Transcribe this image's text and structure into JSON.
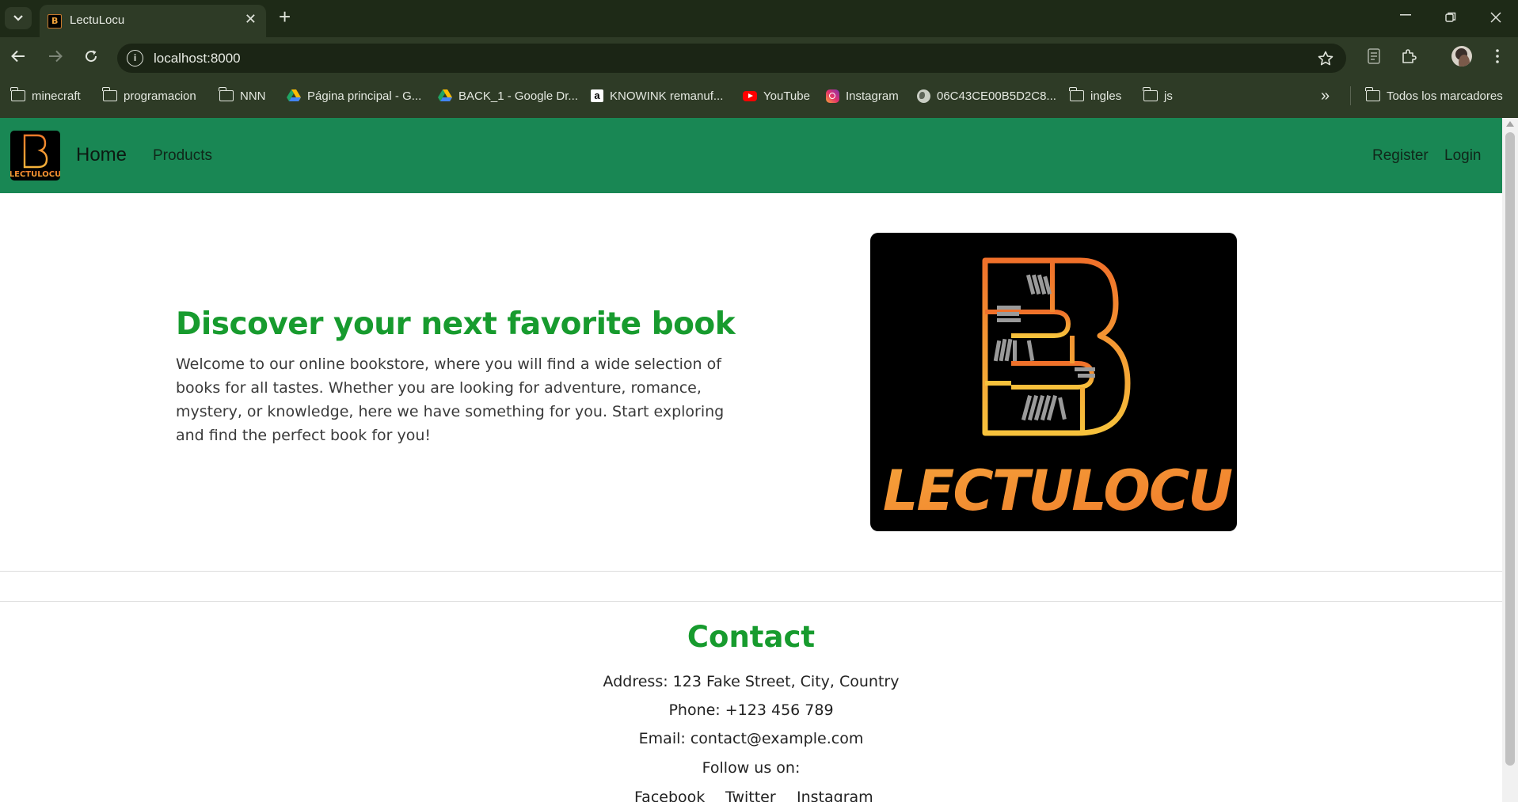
{
  "browser": {
    "tab_title": "LectuLocu",
    "tab_close": "✕",
    "new_tab": "+",
    "url": "localhost:8000",
    "bookmarks": [
      {
        "label": "minecraft",
        "icon": "folder-icon"
      },
      {
        "label": "programacion",
        "icon": "folder-icon"
      },
      {
        "label": "NNN",
        "icon": "folder-icon"
      },
      {
        "label": "Página principal - G...",
        "icon": "google-drive-icon"
      },
      {
        "label": "BACK_1 - Google Dr...",
        "icon": "google-drive-icon"
      },
      {
        "label": "KNOWINK remanuf...",
        "icon": "amazon-icon"
      },
      {
        "label": "YouTube",
        "icon": "youtube-icon"
      },
      {
        "label": "Instagram",
        "icon": "instagram-icon"
      },
      {
        "label": "06C43CE00B5D2C8...",
        "icon": "globe-icon"
      },
      {
        "label": "ingles",
        "icon": "folder-icon"
      },
      {
        "label": "js",
        "icon": "folder-icon"
      }
    ],
    "bookmarks_overflow": "»",
    "all_bookmarks": "Todos los marcadores"
  },
  "nav": {
    "logo_text": "LECTULOCU",
    "home": "Home",
    "products": "Products",
    "register": "Register",
    "login": "Login",
    "color": "#198754"
  },
  "hero": {
    "title": "Discover your next favorite book",
    "text": "Welcome to our online bookstore, where you will find a wide selection of books for all tastes. Whether you are looking for adventure, romance, mystery, or knowledge, here we have something for you. Start exploring and find the perfect book for you!",
    "image_text": "LECTULOCU",
    "accent_color": "#179b2e"
  },
  "contact": {
    "title": "Contact",
    "address": "Address: 123 Fake Street, City, Country",
    "phone": "Phone: +123 456 789",
    "email": "Email: contact@example.com",
    "follow": "Follow us on:",
    "socials": [
      "Facebook",
      "Twitter",
      "Instagram"
    ]
  }
}
